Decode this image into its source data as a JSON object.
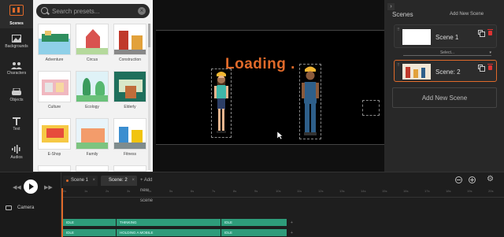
{
  "rail": {
    "items": [
      {
        "label": "Scenes",
        "icon": "scenes-icon"
      },
      {
        "label": "Backgrounds",
        "icon": "backgrounds-icon"
      },
      {
        "label": "Characters",
        "icon": "characters-icon"
      },
      {
        "label": "Objects",
        "icon": "objects-icon"
      },
      {
        "label": "Text",
        "icon": "text-icon"
      },
      {
        "label": "Audios",
        "icon": "audio-icon"
      }
    ]
  },
  "presets": {
    "search_placeholder": "Search presets...",
    "tiles": [
      {
        "label": "Adventure"
      },
      {
        "label": "Circus"
      },
      {
        "label": "Construction"
      },
      {
        "label": "Culture"
      },
      {
        "label": "Ecology"
      },
      {
        "label": "Elderly"
      },
      {
        "label": "E-Shop"
      },
      {
        "label": "Family"
      },
      {
        "label": "Fitness"
      }
    ]
  },
  "canvas": {
    "loading_text": "Loading ."
  },
  "scenes_panel": {
    "title": "Scenes",
    "add_link": "Add New Scene",
    "scenes": [
      {
        "name": "Scene 1"
      },
      {
        "name": "Scene: 2"
      }
    ],
    "select_label": "Select...",
    "add_button": "Add New Scene"
  },
  "timeline": {
    "tabs": [
      {
        "label": "Scene 1"
      },
      {
        "label": "Scene: 2"
      }
    ],
    "add_scene": "+ Add new scene",
    "camera_label": "Camera",
    "ruler_labels": [
      "0s",
      "1s",
      "2s",
      "3s",
      "4s",
      "5s",
      "6s",
      "7s",
      "8s",
      "9s",
      "10s",
      "11s",
      "12s",
      "13s",
      "14s",
      "15s",
      "16s",
      "17s",
      "18s",
      "19s",
      "20s"
    ],
    "track1": [
      {
        "label": "IDLE"
      },
      {
        "label": "THINKING"
      },
      {
        "label": "IDLE"
      }
    ],
    "track2": [
      {
        "label": "IDLE"
      },
      {
        "label": "HOLDING A MOBILE"
      },
      {
        "label": "IDLE"
      }
    ]
  },
  "colors": {
    "accent": "#e06a2a",
    "track": "#2e9c7a",
    "delete": "#dd3333"
  }
}
